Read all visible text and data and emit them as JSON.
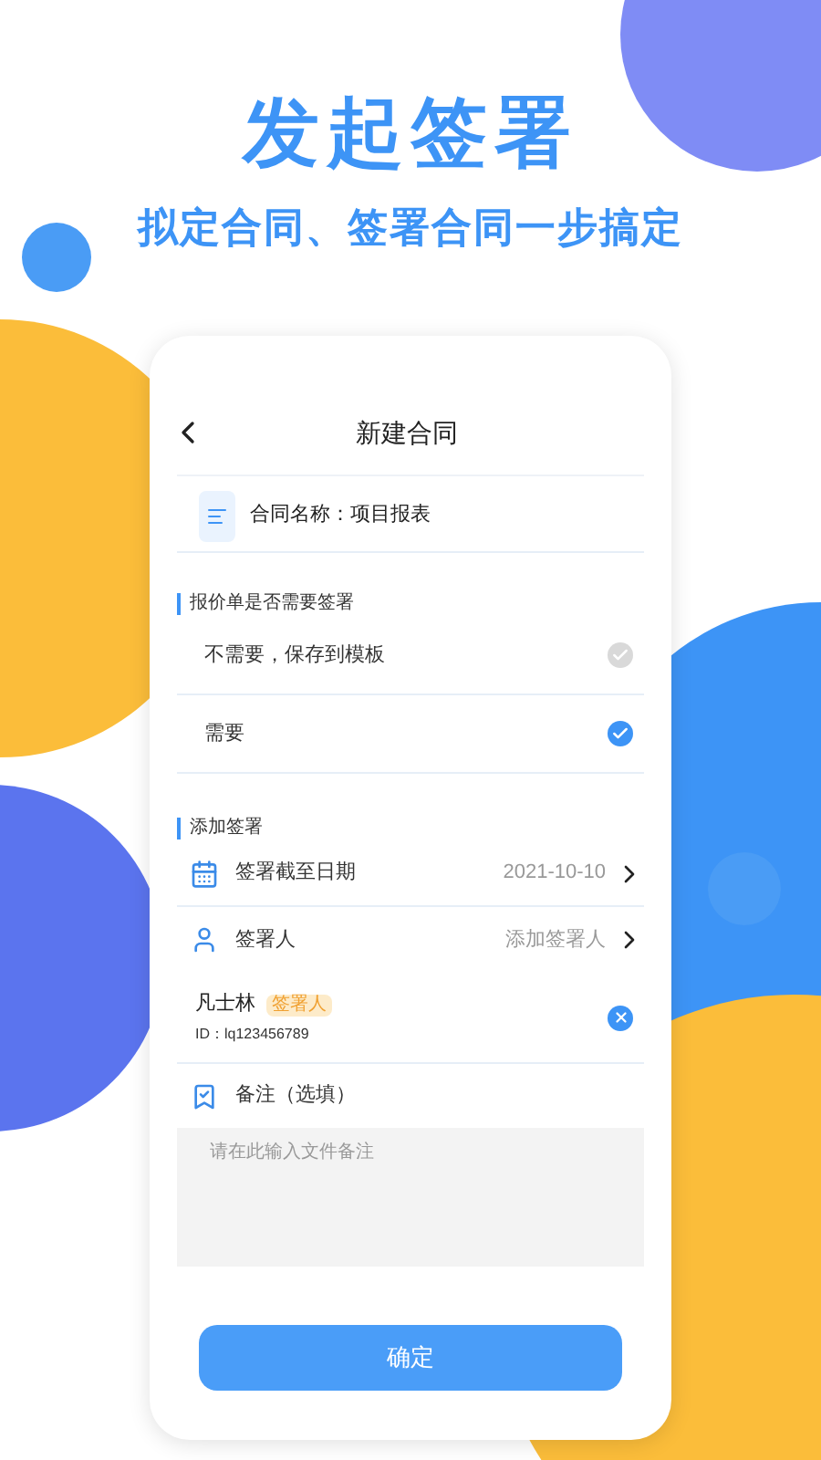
{
  "headline": "发起签署",
  "subheadline": "拟定合同、签署合同一步搞定",
  "screen": {
    "title": "新建合同",
    "contract": {
      "label": "合同名称：项目报表"
    },
    "quote_section": {
      "heading": "报价单是否需要签署",
      "options": [
        {
          "label": "不需要，保存到模板",
          "selected": false
        },
        {
          "label": "需要",
          "selected": true
        }
      ]
    },
    "sign_section": {
      "heading": "添加签署",
      "rows": [
        {
          "kind": "date",
          "label": "签署截至日期",
          "value": "2021-10-10"
        },
        {
          "kind": "signer",
          "label": "签署人",
          "value": "添加签署人"
        }
      ],
      "signers": [
        {
          "name": "凡士林",
          "badge": "签署人",
          "id": "ID：lq123456789"
        }
      ]
    },
    "note": {
      "label": "备注（选填）",
      "placeholder": "请在此输入文件备注"
    },
    "confirm": "确定"
  }
}
